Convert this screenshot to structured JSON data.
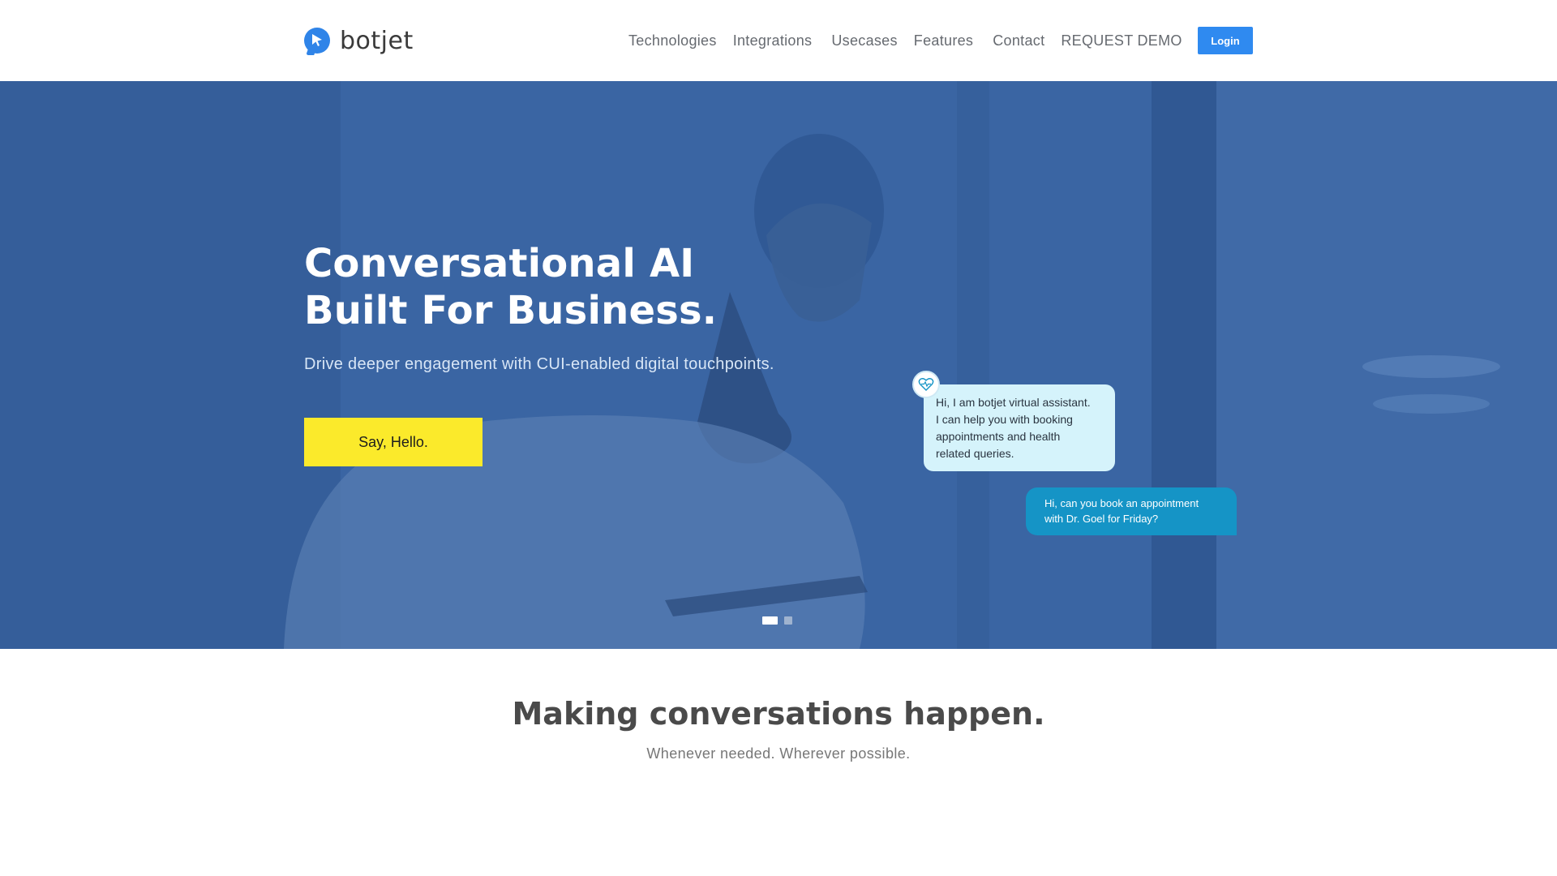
{
  "header": {
    "logo_text": "botjet",
    "nav": [
      {
        "label": "Technologies"
      },
      {
        "label": "Integrations"
      },
      {
        "label": "Usecases"
      },
      {
        "label": "Features"
      },
      {
        "label": "Contact"
      },
      {
        "label": "REQUEST DEMO"
      }
    ],
    "login_label": "Login"
  },
  "hero": {
    "title_line1": "Conversational AI",
    "title_line2": "Built For Business.",
    "subtitle": "Drive deeper engagement with CUI-enabled digital touchpoints.",
    "cta_label": "Say, Hello.",
    "bot_message_lines": [
      "Hi, I am botjet virtual assistant.",
      "I can help you with booking",
      "appointments and health",
      "related queries."
    ],
    "user_message_lines": [
      "Hi, can you book an appointment",
      "with Dr. Goel for Friday?"
    ],
    "carousel": {
      "active_slide": 1,
      "total_slides": 2
    }
  },
  "section": {
    "title": "Making conversations happen.",
    "subtitle": "Whenever needed. Wherever possible."
  },
  "colors": {
    "brand_blue": "#2f84e8",
    "hero_overlay": "#3a66a4",
    "cta_yellow": "#fbea2b",
    "bot_bubble": "#d5f3fb",
    "user_bubble": "#1594c6"
  },
  "icons": [
    "botjet-logo-icon",
    "bot-heart-icon"
  ]
}
